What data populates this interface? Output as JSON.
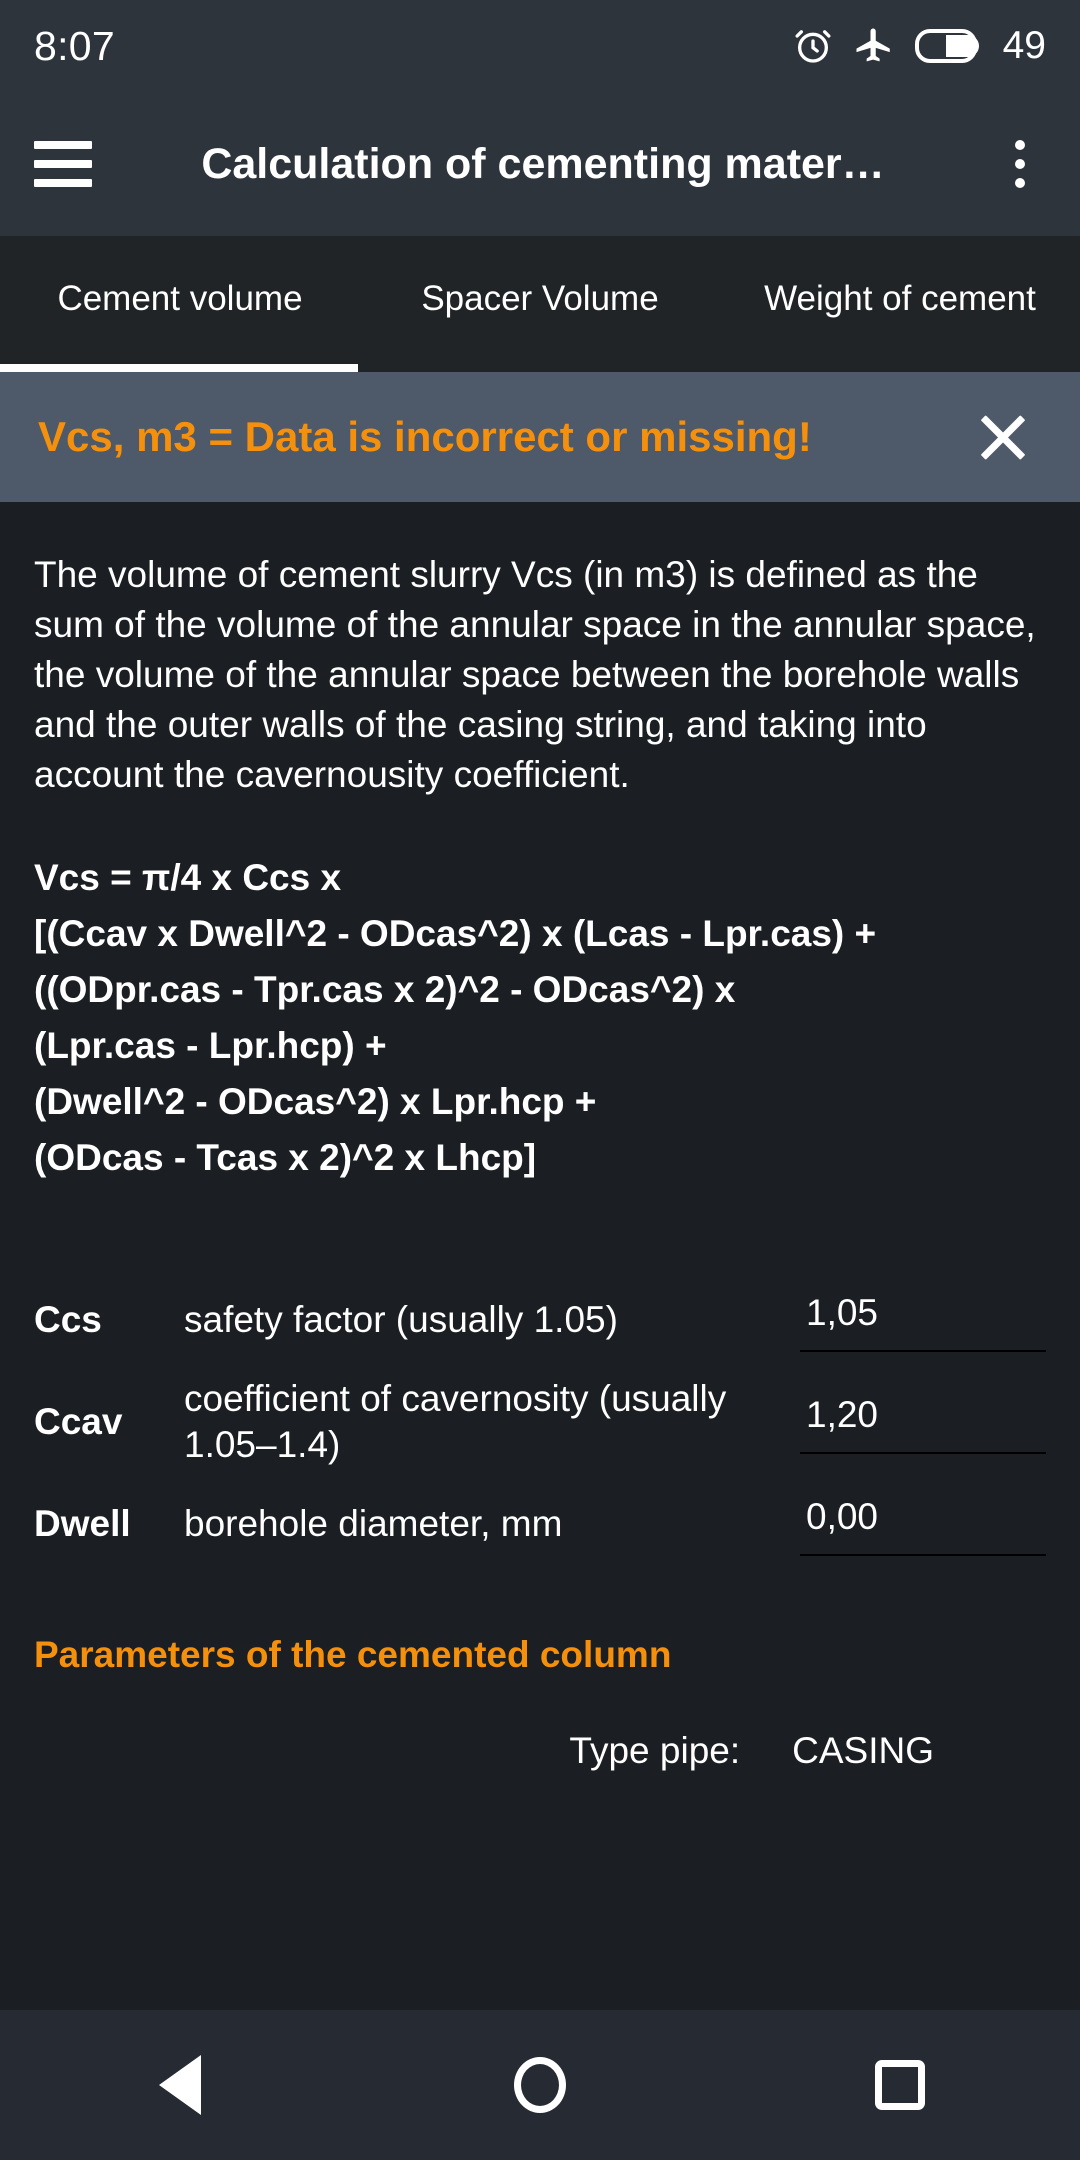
{
  "status_bar": {
    "time": "8:07",
    "battery_percent": "49",
    "icons": [
      "alarm-clock-icon",
      "airplane-mode-icon",
      "battery-icon"
    ]
  },
  "app_bar": {
    "menu_icon": "hamburger-menu-icon",
    "title": "Calculation of cementing mater…",
    "overflow_icon": "more-vertical-icon"
  },
  "tabs": [
    {
      "label": "Cement volume",
      "active": true
    },
    {
      "label": "Spacer Volume",
      "active": false
    },
    {
      "label": "Weight of cement",
      "active": false
    }
  ],
  "alert_banner": {
    "text": "Vcs, m3  =  Data is incorrect or missing!",
    "close_icon": "close-icon",
    "background": "#4e5a69",
    "text_color": "#f5900c"
  },
  "description": "The volume of cement slurry Vcs (in m3) is defined as the sum of the volume of the annular space in the annular space, the volume of the annular space between the borehole walls and the outer walls of the casing string, and taking into account the cavernousity coefficient.",
  "formula": "Vcs = π/4 x Ccs x\n[(Ccav x Dwell^2 - ODcas^2) x (Lcas - Lpr.cas) +\n((ODpr.cas - Tpr.cas x 2)^2 - ODcas^2) x\n(Lpr.cas - Lpr.hcp) +\n(Dwell^2 - ODcas^2) x Lpr.hcp +\n(ODcas - Tcas x 2)^2 x Lhcp]",
  "parameters": [
    {
      "symbol": "Ccs",
      "description": "safety factor (usually 1.05)",
      "value": "1,05"
    },
    {
      "symbol": "Ccav",
      "description": "coefficient of cavernosity (usually 1.05–1.4)",
      "value": "1,20"
    },
    {
      "symbol": "Dwell",
      "description": "borehole diameter, mm",
      "value": "0,00"
    }
  ],
  "section_heading": "Parameters of the cemented column",
  "type_pipe": {
    "label": "Type pipe:",
    "value": "CASING"
  },
  "nav_bar": {
    "back": "back-triangle-icon",
    "home": "home-circle-icon",
    "recents": "recents-square-icon"
  },
  "colors": {
    "accent": "#f5900c",
    "app_bar": "#2d343c",
    "tab_bar": "#212426",
    "body": "#1b1f23",
    "nav_bar": "#262b33"
  }
}
